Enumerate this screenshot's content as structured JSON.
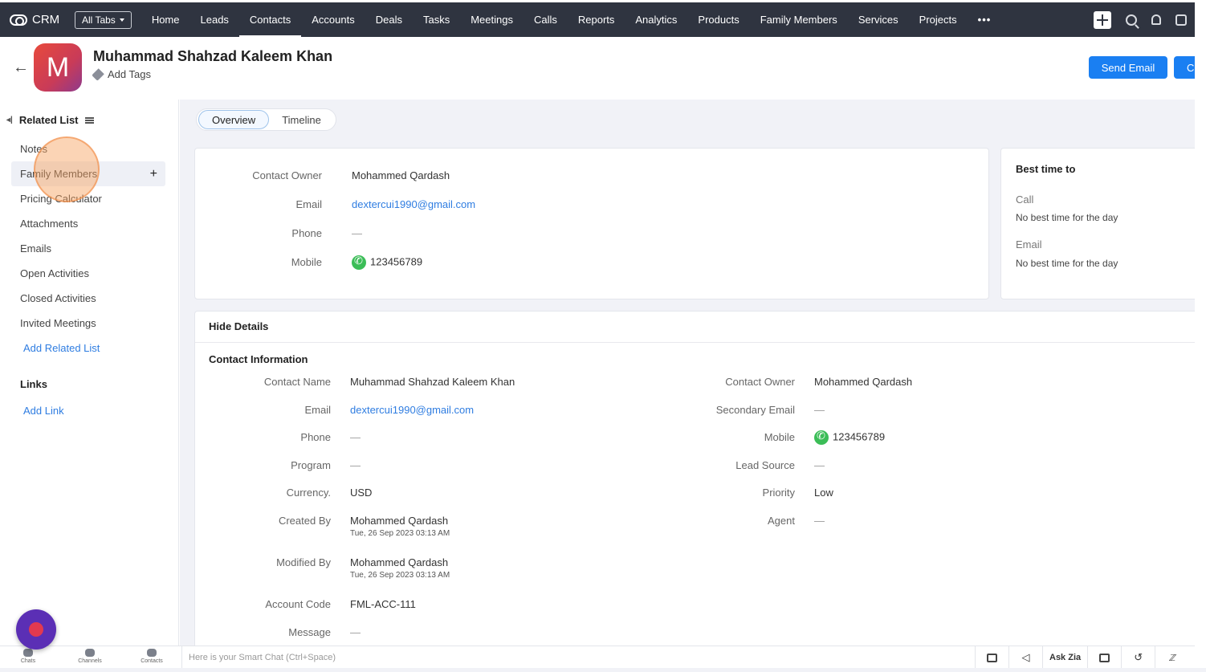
{
  "topnav": {
    "brand": "CRM",
    "all_tabs": "All Tabs",
    "items": [
      "Home",
      "Leads",
      "Contacts",
      "Accounts",
      "Deals",
      "Tasks",
      "Meetings",
      "Calls",
      "Reports",
      "Analytics",
      "Products",
      "Family Members",
      "Services",
      "Projects"
    ],
    "active_index": 2,
    "more": "•••",
    "icons": [
      "plus-icon",
      "search-icon",
      "bell-icon",
      "setup-icon"
    ]
  },
  "header": {
    "avatar_letter": "M",
    "name": "Muhammad Shahzad Kaleem Khan",
    "add_tags": "Add Tags",
    "send_email": "Send Email",
    "cut_button": "C"
  },
  "sidebar": {
    "related_list": "Related List",
    "items": [
      "Notes",
      "Family Members",
      "Pricing Calculator",
      "Attachments",
      "Emails",
      "Open Activities",
      "Closed Activities",
      "Invited Meetings"
    ],
    "active_index": 1,
    "add_related_list": "Add Related List",
    "links": "Links",
    "add_link": "Add Link"
  },
  "tabs": {
    "overview": "Overview",
    "timeline": "Timeline"
  },
  "summary": {
    "contact_owner_label": "Contact Owner",
    "contact_owner": "Mohammed Qardash",
    "email_label": "Email",
    "email": "dextercui1990@gmail.com",
    "phone_label": "Phone",
    "phone": "—",
    "mobile_label": "Mobile",
    "mobile": "123456789"
  },
  "best_time": {
    "title": "Best time to",
    "call_label": "Call",
    "call_value": "No best time for the day",
    "email_label": "Email",
    "email_value": "No best time for the day"
  },
  "details": {
    "hide_details": "Hide Details",
    "section_title": "Contact Information",
    "left": [
      {
        "label": "Contact Name",
        "value": "Muhammad Shahzad Kaleem Khan"
      },
      {
        "label": "Email",
        "value": "dextercui1990@gmail.com"
      },
      {
        "label": "Phone",
        "value": "—"
      },
      {
        "label": "Program",
        "value": "—"
      },
      {
        "label": "Currency.",
        "value": "USD"
      },
      {
        "label": "Created By",
        "value": "Mohammed Qardash",
        "sub": "Tue, 26 Sep 2023 03:13 AM"
      },
      {
        "label": "Modified By",
        "value": "Mohammed Qardash",
        "sub": "Tue, 26 Sep 2023 03:13 AM"
      },
      {
        "label": "Account Code",
        "value": "FML-ACC-111"
      },
      {
        "label": "Message",
        "value": "—"
      }
    ],
    "right": [
      {
        "label": "Contact Owner",
        "value": "Mohammed Qardash"
      },
      {
        "label": "Secondary Email",
        "value": "—"
      },
      {
        "label": "Mobile",
        "value": "123456789"
      },
      {
        "label": "Lead Source",
        "value": "—"
      },
      {
        "label": "Priority",
        "value": "Low"
      },
      {
        "label": "Agent",
        "value": "—"
      }
    ]
  },
  "bottombar": {
    "chats": "Chats",
    "channels": "Channels",
    "contacts": "Contacts",
    "smart_chat_placeholder": "Here is your Smart Chat (Ctrl+Space)",
    "ask_zia": "Ask Zia"
  }
}
